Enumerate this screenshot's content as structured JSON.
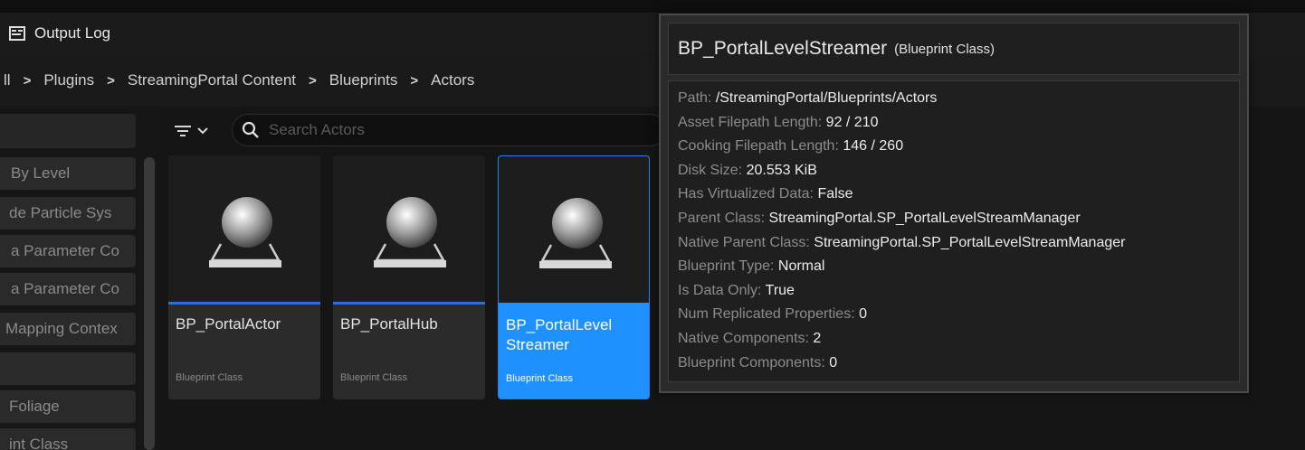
{
  "tab": {
    "label": "Output Log"
  },
  "breadcrumb": {
    "items": [
      "ll",
      "Plugins",
      "StreamingPortal Content",
      "Blueprints",
      "Actors"
    ]
  },
  "sidebar": {
    "items": [
      "By Level",
      "de Particle Sys",
      "a Parameter Co",
      "a Parameter Co",
      "Mapping Contex",
      "",
      "Foliage",
      "int Class"
    ]
  },
  "search": {
    "placeholder": "Search Actors"
  },
  "assets": [
    {
      "name": "BP_PortalActor",
      "type": "Blueprint Class"
    },
    {
      "name": "BP_PortalHub",
      "type": "Blueprint Class"
    },
    {
      "name": "BP_PortalLevel Streamer",
      "type": "Blueprint Class",
      "selected": true
    }
  ],
  "tooltip": {
    "title": "BP_PortalLevelStreamer",
    "subtitle": "(Blueprint Class)",
    "rows": [
      {
        "key": "Path:",
        "value": "/StreamingPortal/Blueprints/Actors"
      },
      {
        "key": "Asset Filepath Length:",
        "value": "92 / 210"
      },
      {
        "key": "Cooking Filepath Length:",
        "value": "146 / 260"
      },
      {
        "key": "Disk Size:",
        "value": "20.553 KiB"
      },
      {
        "key": "Has Virtualized Data:",
        "value": "False"
      },
      {
        "key": "Parent Class:",
        "value": "StreamingPortal.SP_PortalLevelStreamManager"
      },
      {
        "key": "Native Parent Class:",
        "value": "StreamingPortal.SP_PortalLevelStreamManager"
      },
      {
        "key": "Blueprint Type:",
        "value": "Normal"
      },
      {
        "key": "Is Data Only:",
        "value": "True"
      },
      {
        "key": "Num Replicated Properties:",
        "value": "0"
      },
      {
        "key": "Native Components:",
        "value": "2"
      },
      {
        "key": "Blueprint Components:",
        "value": "0"
      }
    ]
  },
  "icons": {
    "tab": "output-log-icon",
    "filter": "filter-icon",
    "search": "search-icon",
    "thumbnail": "blueprint-sphere-icon"
  },
  "colors": {
    "selection": "#1e90ff",
    "accent_bar": "#2f6fd6",
    "background": "#151515"
  }
}
